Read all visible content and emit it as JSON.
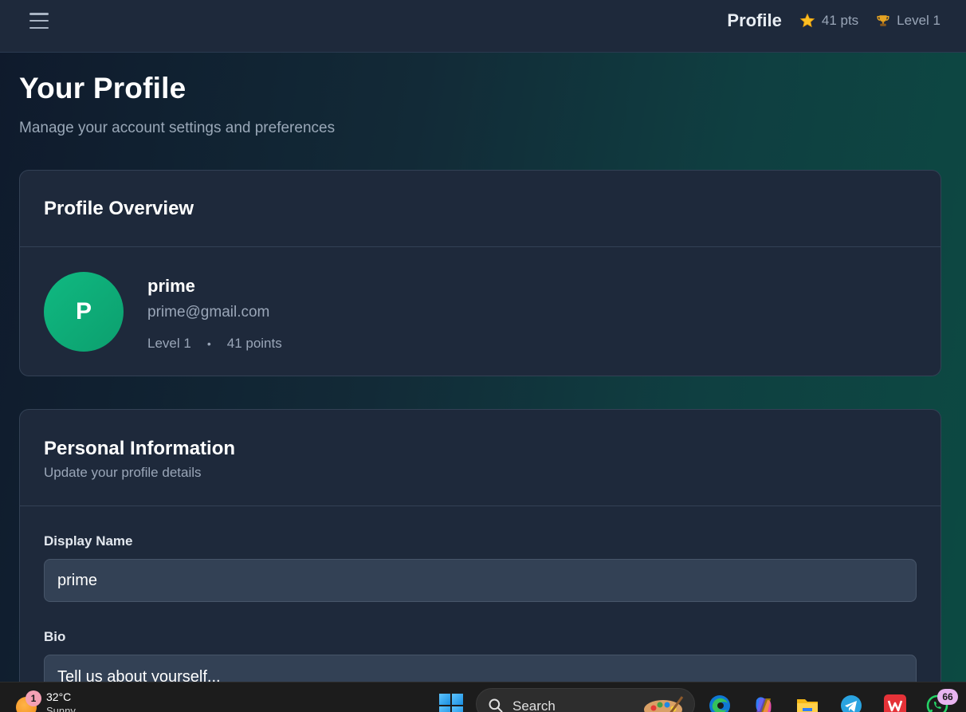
{
  "topbar": {
    "title": "Profile",
    "points": "41 pts",
    "level": "Level 1"
  },
  "page": {
    "title": "Your Profile",
    "subtitle": "Manage your account settings and preferences"
  },
  "overview": {
    "title": "Profile Overview",
    "avatar_initial": "P",
    "name": "prime",
    "email": "prime@gmail.com",
    "level": "Level 1",
    "separator": "•",
    "points": "41 points"
  },
  "personal": {
    "title": "Personal Information",
    "description": "Update your profile details",
    "display_name_label": "Display Name",
    "display_name_value": "prime",
    "bio_label": "Bio",
    "bio_placeholder": "Tell us about yourself..."
  },
  "taskbar": {
    "notification_count": "1",
    "temperature": "32°C",
    "condition": "Sunny",
    "search_label": "Search",
    "whatsapp_badge": "66"
  },
  "colors": {
    "accent_green": "#10b981",
    "card_bg": "#1e293b",
    "input_bg": "#334155"
  }
}
